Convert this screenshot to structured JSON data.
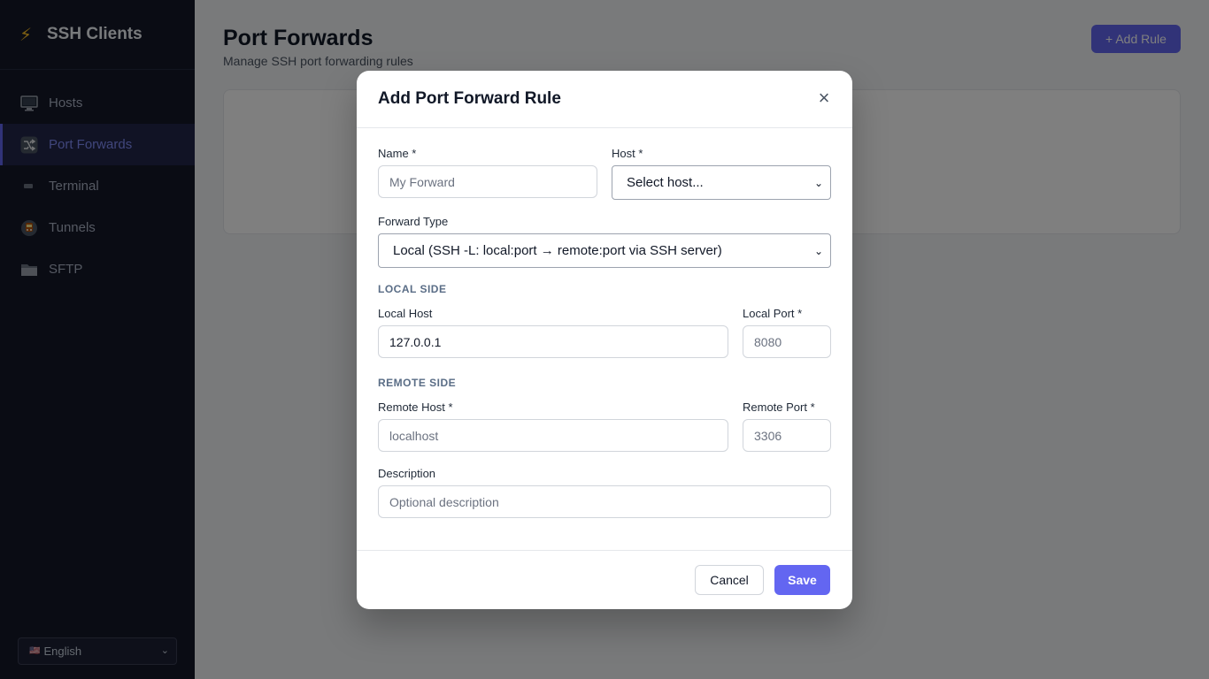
{
  "app": {
    "title": "SSH Clients",
    "logo_icon": "lightning-icon"
  },
  "sidebar": {
    "items": [
      {
        "label": "Hosts",
        "icon": "monitor-icon",
        "active": false
      },
      {
        "label": "Port Forwards",
        "icon": "shuffle-icon",
        "active": true
      },
      {
        "label": "Terminal",
        "icon": "terminal-icon",
        "active": false
      },
      {
        "label": "Tunnels",
        "icon": "train-icon",
        "active": false
      },
      {
        "label": "SFTP",
        "icon": "folder-icon",
        "active": false
      }
    ],
    "language": {
      "flag": "🇺🇸",
      "value": "English"
    }
  },
  "page": {
    "title": "Port Forwards",
    "subtitle": "Manage SSH port forwarding rules",
    "add_button": "+ Add Rule"
  },
  "modal": {
    "title": "Add Port Forward Rule",
    "close": "×",
    "name": {
      "label": "Name *",
      "placeholder": "My Forward",
      "value": ""
    },
    "host": {
      "label": "Host *",
      "selected": "Select host..."
    },
    "forward_type": {
      "label": "Forward Type",
      "selected": "Local (SSH -L: local:port → remote:port via SSH server)"
    },
    "local_section": "LOCAL SIDE",
    "local_host": {
      "label": "Local Host",
      "value": "127.0.0.1"
    },
    "local_port": {
      "label": "Local Port *",
      "placeholder": "8080"
    },
    "remote_section": "REMOTE SIDE",
    "remote_host": {
      "label": "Remote Host *",
      "placeholder": "localhost"
    },
    "remote_port": {
      "label": "Remote Port *",
      "placeholder": "3306"
    },
    "description": {
      "label": "Description",
      "placeholder": "Optional description"
    },
    "cancel": "Cancel",
    "save": "Save"
  },
  "colors": {
    "accent": "#6366f1",
    "sidebar_bg": "#151829",
    "overlay": "rgba(0,0,0,0.5)"
  }
}
